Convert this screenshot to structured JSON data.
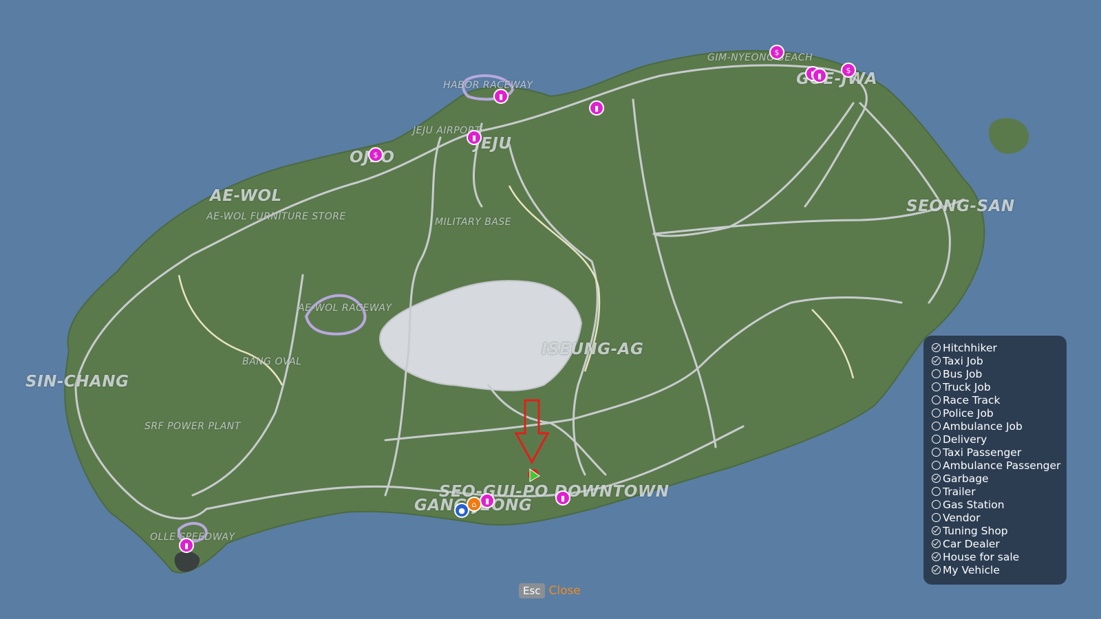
{
  "map": {
    "places": [
      {
        "id": "jeju",
        "label": "JEJU",
        "size": "big"
      },
      {
        "id": "ae-wol",
        "label": "AE-WOL",
        "size": "big"
      },
      {
        "id": "ojeo",
        "label": "OJEO",
        "size": "big"
      },
      {
        "id": "seong-san",
        "label": "SEONG-SAN",
        "size": "big"
      },
      {
        "id": "sin-chang",
        "label": "SIN-CHANG",
        "size": "big"
      },
      {
        "id": "seung-ag",
        "label": "ISEUNG-AG",
        "size": "big"
      },
      {
        "id": "goe-jwa",
        "label": "GOE-JWA",
        "size": "big"
      },
      {
        "id": "seo-gui-po",
        "label": "SEO-GUI-PO DOWNTOWN",
        "size": "big"
      },
      {
        "id": "gang-jeong",
        "label": "GANG-JEONG",
        "size": "big"
      },
      {
        "id": "habor-raceway",
        "label": "HABOR RACEWAY",
        "size": "small"
      },
      {
        "id": "jeju-airport",
        "label": "JEJU AIRPORT",
        "size": "small"
      },
      {
        "id": "gim-nyeong-beach",
        "label": "GIM-NYEONG BEACH",
        "size": "small"
      },
      {
        "id": "furniture-store",
        "label": "AE-WOL FURNITURE STORE",
        "size": "small"
      },
      {
        "id": "military-base",
        "label": "MILITARY BASE",
        "size": "small"
      },
      {
        "id": "ae-wol-raceway",
        "label": "AE-WOL RACEWAY",
        "size": "small"
      },
      {
        "id": "bang-oval",
        "label": "BANG OVAL",
        "size": "small"
      },
      {
        "id": "srf-power-plant",
        "label": "SRF POWER PLANT",
        "size": "small"
      },
      {
        "id": "olle-speedway",
        "label": "OLLE SPEEDWAY",
        "size": "small"
      }
    ],
    "markers": [
      {
        "type": "taxi",
        "icon": "taxi-icon",
        "color": "#e020d0"
      },
      {
        "type": "house",
        "icon": "house-icon",
        "color": "#e020d0"
      },
      {
        "type": "car-dealer",
        "icon": "car-icon",
        "color": "#e020d0"
      },
      {
        "type": "my-vehicle",
        "icon": "car-front-icon",
        "color": "#2860d0"
      },
      {
        "type": "home",
        "icon": "home-icon",
        "color": "#f07a10"
      }
    ],
    "player_marker": {
      "icon": "player-arrow-icon",
      "color": "#3ec83a",
      "pointer_color": "#e0201a"
    }
  },
  "legend": {
    "items": [
      {
        "label": "Hitchhiker",
        "checked": true
      },
      {
        "label": "Taxi Job",
        "checked": true
      },
      {
        "label": "Bus Job",
        "checked": false
      },
      {
        "label": "Truck Job",
        "checked": false
      },
      {
        "label": "Race Track",
        "checked": false
      },
      {
        "label": "Police Job",
        "checked": false
      },
      {
        "label": "Ambulance Job",
        "checked": false
      },
      {
        "label": "Delivery",
        "checked": false
      },
      {
        "label": "Taxi Passenger",
        "checked": false
      },
      {
        "label": "Ambulance Passenger",
        "checked": false
      },
      {
        "label": "Garbage",
        "checked": true
      },
      {
        "label": "Trailer",
        "checked": false
      },
      {
        "label": "Gas Station",
        "checked": false
      },
      {
        "label": "Vendor",
        "checked": false
      },
      {
        "label": "Tuning Shop",
        "checked": true
      },
      {
        "label": "Car Dealer",
        "checked": true
      },
      {
        "label": "House for sale",
        "checked": true
      },
      {
        "label": "My Vehicle",
        "checked": true
      }
    ]
  },
  "footer": {
    "key": "Esc",
    "label": "Close"
  }
}
